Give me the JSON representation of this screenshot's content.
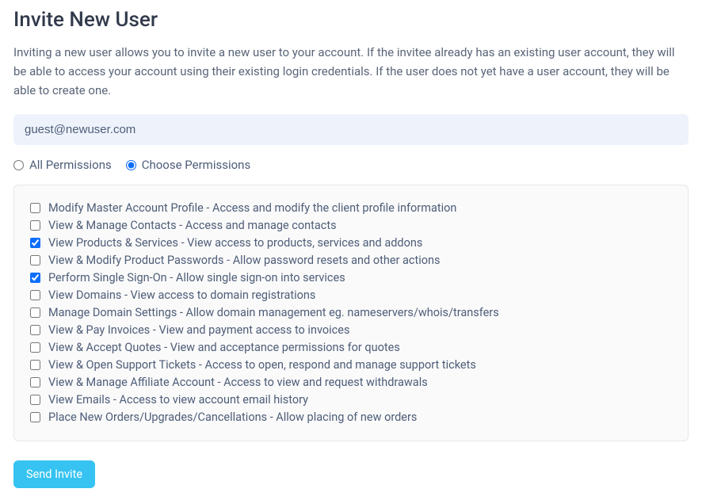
{
  "header": {
    "title": "Invite New User",
    "description": "Inviting a new user allows you to invite a new user to your account. If the invitee already has an existing user account, they will be able to access your account using their existing login credentials. If the user does not yet have a user account, they will be able to create one."
  },
  "email": {
    "value": "guest@newuser.com"
  },
  "permission_mode": {
    "all_label": "All Permissions",
    "choose_label": "Choose Permissions",
    "selected": "choose"
  },
  "permissions": [
    {
      "label": "Modify Master Account Profile - Access and modify the client profile information",
      "checked": false
    },
    {
      "label": "View & Manage Contacts - Access and manage contacts",
      "checked": false
    },
    {
      "label": "View Products & Services - View access to products, services and addons",
      "checked": true
    },
    {
      "label": "View & Modify Product Passwords - Allow password resets and other actions",
      "checked": false
    },
    {
      "label": "Perform Single Sign-On - Allow single sign-on into services",
      "checked": true
    },
    {
      "label": "View Domains - View access to domain registrations",
      "checked": false
    },
    {
      "label": "Manage Domain Settings - Allow domain management eg. nameservers/whois/transfers",
      "checked": false
    },
    {
      "label": "View & Pay Invoices - View and payment access to invoices",
      "checked": false
    },
    {
      "label": "View & Accept Quotes - View and acceptance permissions for quotes",
      "checked": false
    },
    {
      "label": "View & Open Support Tickets - Access to open, respond and manage support tickets",
      "checked": false
    },
    {
      "label": "View & Manage Affiliate Account - Access to view and request withdrawals",
      "checked": false
    },
    {
      "label": "View Emails - Access to view account email history",
      "checked": false
    },
    {
      "label": "Place New Orders/Upgrades/Cancellations - Allow placing of new orders",
      "checked": false
    }
  ],
  "actions": {
    "send_label": "Send Invite"
  }
}
